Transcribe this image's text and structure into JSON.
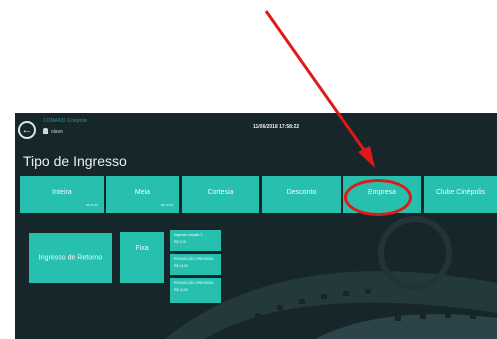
{
  "header": {
    "app_title": "COMAND Cinépolis",
    "user": "olavo",
    "datetime": "11/06/2018 17:58:22"
  },
  "page": {
    "title": "Tipo de Ingresso"
  },
  "tiles": {
    "inteira": {
      "label": "Inteira",
      "price": "R$ 31,00"
    },
    "meia": {
      "label": "Meia",
      "price": "R$ 15,50"
    },
    "cortesia": {
      "label": "Cortesia"
    },
    "desconto": {
      "label": "Desconto"
    },
    "empresa": {
      "label": "Empresa"
    },
    "clube": {
      "label": "Clube Cinépolis"
    },
    "retorno": {
      "label": "Ingresso de Retorno"
    },
    "fixa": {
      "label": "Fixa"
    }
  },
  "small_tiles": [
    {
      "title": "Ingresso sessão 3",
      "value": "R$ 3,00"
    },
    {
      "title": "PROMOÇÃO 2ªSESSÃO",
      "value": "R$ 14,00"
    },
    {
      "title": "PROMOÇÃO 3ªSESSÃO",
      "value": "R$ 10,00"
    }
  ],
  "colors": {
    "tile": "#27bfae",
    "background": "#17262a",
    "annotation": "#e01818"
  }
}
